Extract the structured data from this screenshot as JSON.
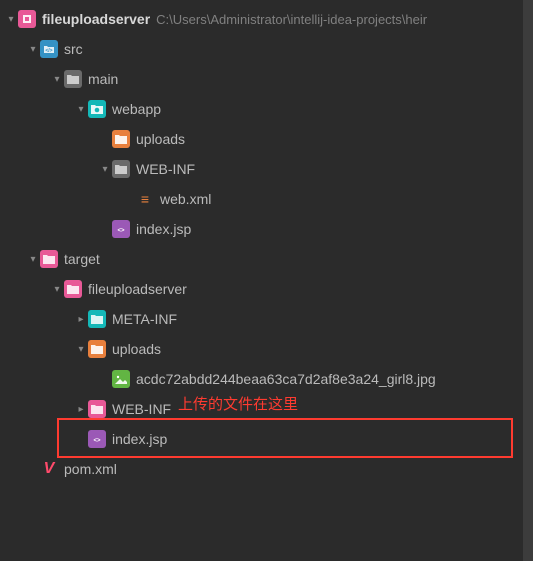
{
  "root": {
    "name": "fileuploadserver",
    "path_hint": "C:\\Users\\Administrator\\intellij-idea-projects\\heir"
  },
  "nodes": {
    "src": "src",
    "main": "main",
    "webapp": "webapp",
    "uploads1": "uploads",
    "webinf1": "WEB-INF",
    "webxml": "web.xml",
    "indexjsp1": "index.jsp",
    "target": "target",
    "fileuploadserver": "fileuploadserver",
    "metainf": "META-INF",
    "uploads2": "uploads",
    "uploaded_file": "acdc72abdd244beaa63ca7d2af8e3a24_girl8.jpg",
    "webinf2": "WEB-INF",
    "indexjsp2": "index.jsp",
    "pomxml": "pom.xml"
  },
  "annotation": {
    "text": "上传的文件在这里"
  }
}
